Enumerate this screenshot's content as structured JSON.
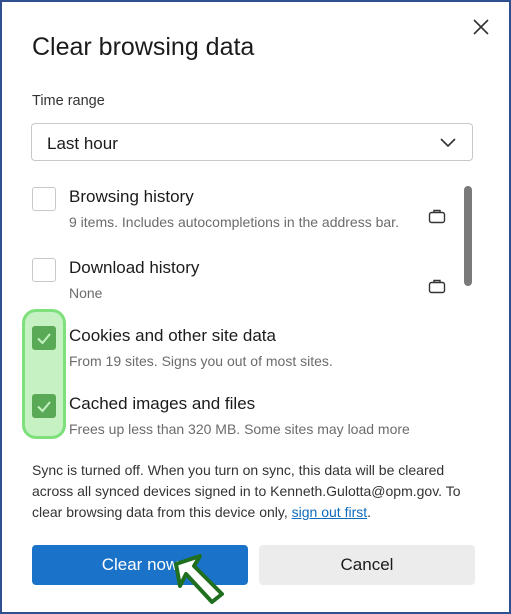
{
  "dialog": {
    "title": "Clear browsing data",
    "close_icon": "close-icon"
  },
  "time_range": {
    "label": "Time range",
    "selected": "Last hour"
  },
  "items": [
    {
      "title": "Browsing history",
      "description": "9 items. Includes autocompletions in the address bar.",
      "checked": false,
      "icon": "briefcase-icon"
    },
    {
      "title": "Download history",
      "description": "None",
      "checked": false,
      "icon": "briefcase-icon"
    },
    {
      "title": "Cookies and other site data",
      "description": "From 19 sites. Signs you out of most sites.",
      "checked": true
    },
    {
      "title": "Cached images and files",
      "description": "Frees up less than 320 MB. Some sites may load more",
      "checked": true
    }
  ],
  "sync": {
    "text": "Sync is turned off. When you turn on sync, this data will be cleared across all synced devices signed in to Kenneth.Gulotta@opm.gov. To clear browsing data from this device only,",
    "link": "sign out first",
    "suffix": "."
  },
  "buttons": {
    "clear_now": "Clear now",
    "cancel": "Cancel"
  },
  "colors": {
    "accent": "#1a73c8",
    "checkbox_checked": "#3c7d3a",
    "highlight": "#7ee07a",
    "link": "#0f6cbd"
  }
}
